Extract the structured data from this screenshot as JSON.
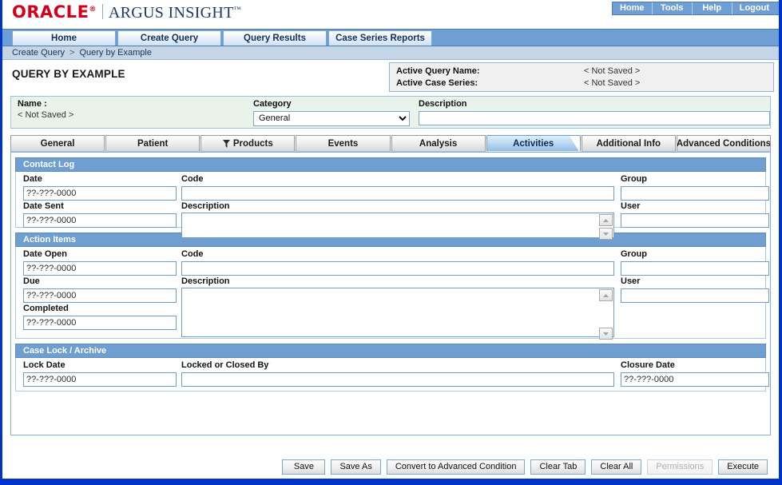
{
  "brand": {
    "oracle": "ORACLE",
    "product": "ARGUS INSIGHT",
    "trademark": "™"
  },
  "topnav": [
    {
      "label": "Home"
    },
    {
      "label": "Tools"
    },
    {
      "label": "Help"
    },
    {
      "label": "Logout"
    }
  ],
  "mainnav": [
    {
      "label": "Home"
    },
    {
      "label": "Create Query"
    },
    {
      "label": "Query Results"
    },
    {
      "label": "Case Series Reports"
    }
  ],
  "breadcrumb": {
    "first": "Create Query",
    "separator": ">",
    "second": "Query by Example"
  },
  "page": {
    "title": "QUERY BY EXAMPLE"
  },
  "active_panel": {
    "query_name_label": "Active Query Name:",
    "query_name_value": "< Not Saved >",
    "case_series_label": "Active Case Series:",
    "case_series_value": "< Not Saved >"
  },
  "namebar": {
    "name_label": "Name :",
    "name_value": "< Not Saved >",
    "category_label": "Category",
    "category_value": "General",
    "description_label": "Description",
    "description_value": "",
    "description_placeholder": ""
  },
  "tabs": [
    {
      "label": "General",
      "icon": "",
      "active": false
    },
    {
      "label": "Patient",
      "icon": "",
      "active": false
    },
    {
      "label": "Products",
      "icon": "funnel-icon",
      "active": false
    },
    {
      "label": "Events",
      "icon": "",
      "active": false
    },
    {
      "label": "Analysis",
      "icon": "",
      "active": false
    },
    {
      "label": "Activities",
      "icon": "",
      "active": true
    },
    {
      "label": "Additional Info",
      "icon": "",
      "active": false
    },
    {
      "label": "Advanced Conditions",
      "icon": "",
      "active": false
    }
  ],
  "sections": {
    "contact_log": {
      "title": "Contact Log",
      "date_label": "Date",
      "date_value": "??-???-0000",
      "code_label": "Code",
      "code_value": "",
      "group_label": "Group",
      "group_value": "",
      "date_sent_label": "Date Sent",
      "date_sent_value": "??-???-0000",
      "description_label": "Description",
      "description_value": "",
      "user_label": "User",
      "user_value": ""
    },
    "action_items": {
      "title": "Action Items",
      "date_open_label": "Date Open",
      "date_open_value": "??-???-0000",
      "code_label": "Code",
      "code_value": "",
      "group_label": "Group",
      "group_value": "",
      "due_label": "Due",
      "due_value": "??-???-0000",
      "description_label": "Description",
      "description_value": "",
      "user_label": "User",
      "user_value": "",
      "completed_label": "Completed",
      "completed_value": "??-???-0000"
    },
    "case_lock": {
      "title": "Case Lock / Archive",
      "lock_date_label": "Lock Date",
      "lock_date_value": "??-???-0000",
      "locked_by_label": "Locked or Closed By",
      "locked_by_value": "",
      "closure_date_label": "Closure Date",
      "closure_date_value": "??-???-0000"
    }
  },
  "buttons": [
    {
      "label": "Save",
      "disabled": false
    },
    {
      "label": "Save As",
      "disabled": false
    },
    {
      "label": "Convert to Advanced Condition",
      "disabled": false
    },
    {
      "label": "Clear Tab",
      "disabled": false
    },
    {
      "label": "Clear All",
      "disabled": false
    },
    {
      "label": "Permissions",
      "disabled": true
    },
    {
      "label": "Execute",
      "disabled": false
    }
  ],
  "colors": {
    "oracle_red": "#d4001a",
    "brand_blue": "#1a3a66",
    "frame_blue": "#0033cc",
    "nav_blue": "#6d9fd4",
    "section_header": "#6f9fd0",
    "breadcrumb_bg": "#c5d5e8",
    "namebar_bg": "#eaf3ea"
  }
}
